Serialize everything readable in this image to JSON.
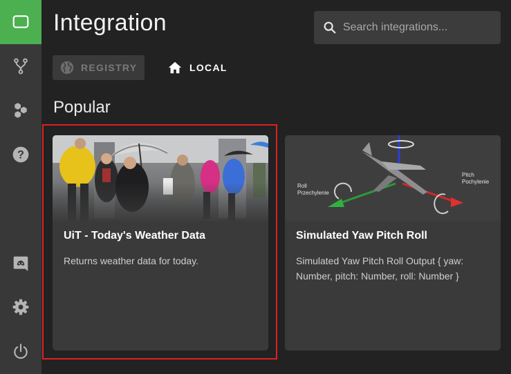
{
  "header": {
    "title": "Integration",
    "search_placeholder": "Search integrations..."
  },
  "tabs": [
    {
      "label": "REGISTRY",
      "icon": "globe-icon",
      "active": false
    },
    {
      "label": "LOCAL",
      "icon": "home-icon",
      "active": true
    }
  ],
  "section_title": "Popular",
  "sidebar": {
    "items": [
      {
        "icon": "dashboard-icon",
        "active": true
      },
      {
        "icon": "fork-icon",
        "active": false
      },
      {
        "icon": "hexagons-icon",
        "active": false
      },
      {
        "icon": "help-icon",
        "active": false
      },
      {
        "icon": "discord-icon",
        "active": false
      },
      {
        "icon": "gear-icon",
        "active": false
      },
      {
        "icon": "power-icon",
        "active": false
      }
    ],
    "accent_color": "#4caf50"
  },
  "cards": [
    {
      "title": "UiT - Today's Weather Data",
      "description": "Returns weather data for today.",
      "image": "rainy-street-photo"
    },
    {
      "title": "Simulated Yaw Pitch Roll",
      "description": "Simulated Yaw Pitch Roll Output { yaw: Number, pitch: Number, roll: Number }",
      "image": "aircraft-axes-diagram",
      "image_labels": {
        "roll": "Roll",
        "roll_pl": "Przechylenie",
        "pitch": "Pitch",
        "pitch_pl": "Pochylenie"
      }
    }
  ]
}
